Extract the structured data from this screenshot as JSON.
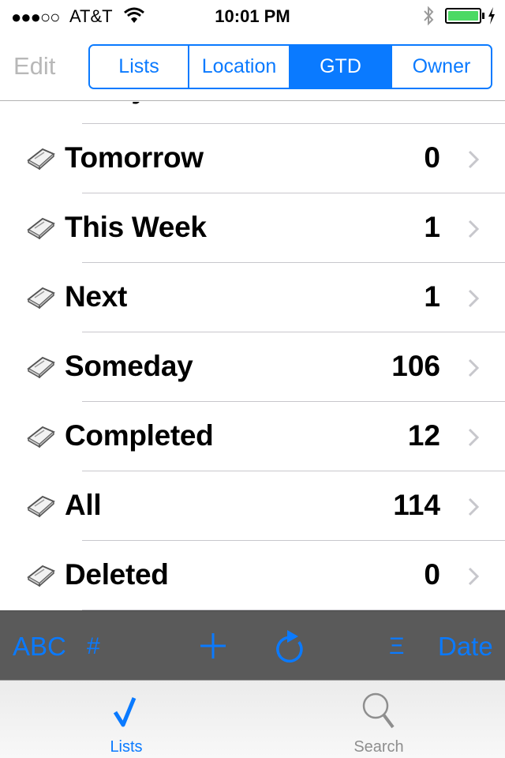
{
  "status_bar": {
    "signal": "●●●○○",
    "carrier": "AT&T",
    "time": "10:01 PM",
    "battery_color": "#4cd964",
    "icons": [
      "wifi-icon",
      "bluetooth-icon",
      "battery-icon",
      "charging-bolt-icon"
    ]
  },
  "nav": {
    "edit_label": "Edit",
    "segments": [
      {
        "label": "Lists",
        "selected": false
      },
      {
        "label": "Location",
        "selected": false
      },
      {
        "label": "GTD",
        "selected": true
      },
      {
        "label": "Owner",
        "selected": false
      }
    ]
  },
  "list": {
    "partial_top_row": "Today",
    "rows": [
      {
        "label": "Tomorrow",
        "count": "0"
      },
      {
        "label": "This Week",
        "count": "1"
      },
      {
        "label": "Next",
        "count": "1"
      },
      {
        "label": "Someday",
        "count": "106"
      },
      {
        "label": "Completed",
        "count": "12"
      },
      {
        "label": "All",
        "count": "114"
      },
      {
        "label": "Deleted",
        "count": "0"
      }
    ]
  },
  "toolbar": {
    "abc_label": "ABC",
    "hash_label": "#",
    "sort_label": "Ξ",
    "date_label": "Date",
    "add_icon": "plus-icon",
    "refresh_icon": "refresh-icon"
  },
  "tab_bar": {
    "tabs": [
      {
        "label": "Lists",
        "icon": "checkmark-icon",
        "selected": true
      },
      {
        "label": "Search",
        "icon": "search-icon",
        "selected": false
      }
    ]
  },
  "colors": {
    "accent": "#0a7aff",
    "toolbar_bg": "#5a5a5a",
    "edit_disabled": "#b8b8b8"
  }
}
